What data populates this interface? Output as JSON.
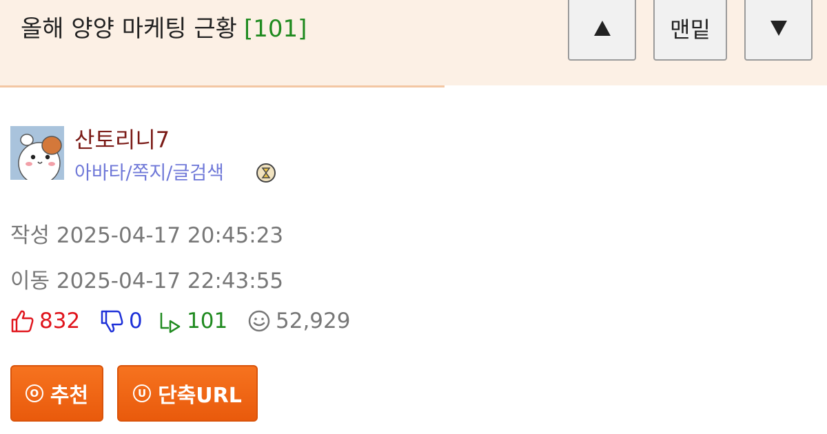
{
  "post": {
    "title": "올해 양양 마케팅 근황",
    "comment_count": "[101]"
  },
  "nav": {
    "up_icon": "triangle-up-icon",
    "bottom_label": "맨밑",
    "down_icon": "triangle-down-icon"
  },
  "author": {
    "name": "산토리니7",
    "links": "아바타/쪽지/글검색",
    "avatar_icon": "hamster-avatar",
    "badge_icon": "hourglass-badge-icon"
  },
  "meta": {
    "written_label": "작성",
    "written_time": "2025-04-17 20:45:23",
    "moved_label": "이동",
    "moved_time": "2025-04-17 22:43:55"
  },
  "stats": {
    "upvotes": "832",
    "downvotes": "0",
    "replies": "101",
    "views": "52,929"
  },
  "actions": {
    "recommend_icon_letter": "O",
    "recommend_label": "추천",
    "shorturl_icon_letter": "U",
    "shorturl_label": "단축URL"
  },
  "colors": {
    "header_bg": "#fcf0e5",
    "comment_count": "#1f8a1f",
    "author_name": "#7a1a16",
    "author_links": "#6f78d8",
    "upvote": "#e0141c",
    "downvote": "#1d30d8",
    "reply": "#1f8a1f",
    "button_orange": "#f26a18"
  }
}
